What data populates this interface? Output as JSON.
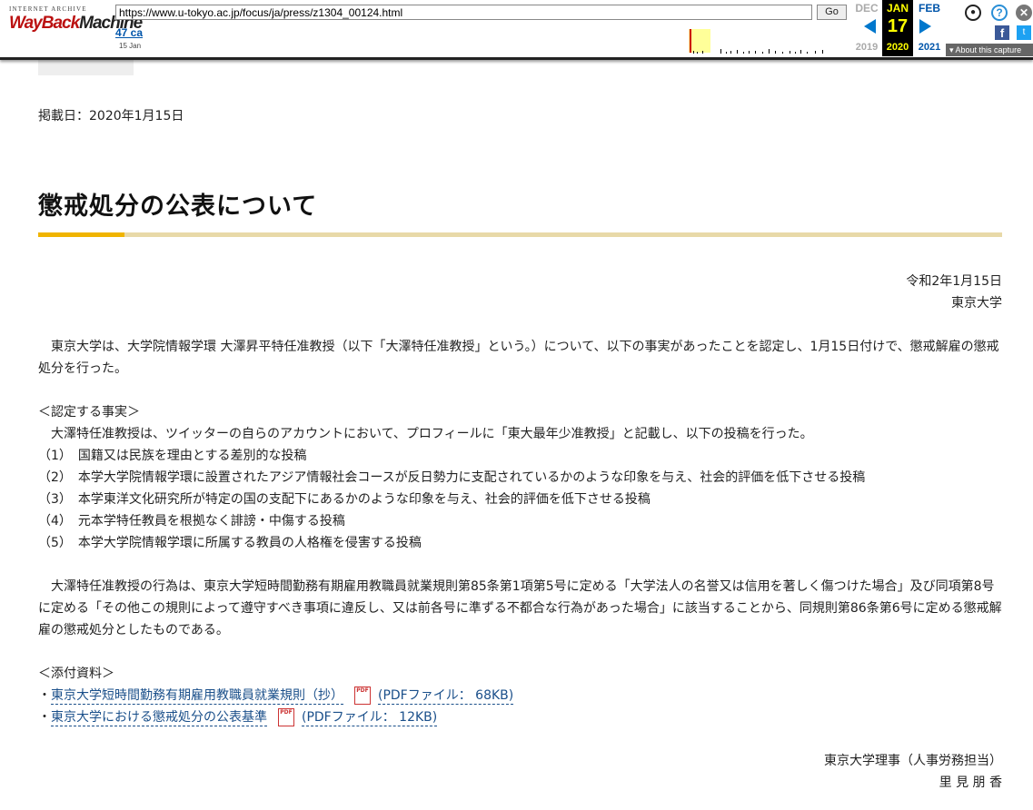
{
  "wayback": {
    "logo_top": "INTERNET ARCHIVE",
    "logo_main_a": "WayBack",
    "logo_main_b": "Machine",
    "url": "https://www.u-tokyo.ac.jp/focus/ja/press/z1304_00124.html",
    "go_label": "Go",
    "captures": "47 ca",
    "captures_date": "15 Jan",
    "prev_month": "DEC",
    "cur_month": "JAN",
    "next_month": "FEB",
    "day": "17",
    "prev_year": "2019",
    "cur_year": "2020",
    "next_year": "2021",
    "about": "About this capture",
    "close_glyph": "✕",
    "help_glyph": "?",
    "facebook_glyph": "f",
    "twitter_glyph": "t"
  },
  "page": {
    "post_date": "掲載日：2020年1月15日",
    "title": "懲戒処分の公表について",
    "issue_date": "令和2年1月15日",
    "issuer": "東京大学",
    "intro": "東京大学は、大学院情報学環 大澤昇平特任准教授（以下「大澤特任准教授」という。）について、以下の事実があったことを認定し、1月15日付けで、懲戒解雇の懲戒処分を行った。",
    "facts_heading": "＜認定する事実＞",
    "facts_intro": "　大澤特任准教授は、ツイッターの自らのアカウントにおいて、プロフィールに「東大最年少准教授」と記載し、以下の投稿を行った。",
    "facts": [
      "（1）　国籍又は民族を理由とする差別的な投稿",
      "（2）　本学大学院情報学環に設置されたアジア情報社会コースが反日勢力に支配されているかのような印象を与え、社会的評価を低下させる投稿",
      "（3）　本学東洋文化研究所が特定の国の支配下にあるかのような印象を与え、社会的評価を低下させる投稿",
      "（4）　元本学特任教員を根拠なく誹謗・中傷する投稿",
      "（5）　本学大学院情報学環に所属する教員の人格権を侵害する投稿"
    ],
    "conclusion": "大澤特任准教授の行為は、東京大学短時間勤務有期雇用教職員就業規則第85条第1項第5号に定める「大学法人の名誉又は信用を著しく傷つけた場合」及び同項第8号に定める「その他この規則によって遵守すべき事項に違反し、又は前各号に準ずる不都合な行為があった場合」に該当することから、同規則第86条第6号に定める懲戒解雇の懲戒処分としたものである。",
    "attachments_heading": "＜添付資料＞",
    "attachments": [
      {
        "bullet": "・",
        "label": "東京大学短時間勤務有期雇用教職員就業規則（抄）",
        "file_info": "(PDFファイル： 68KB)"
      },
      {
        "bullet": "・",
        "label": "東京大学における懲戒処分の公表基準",
        "file_info": "(PDFファイル： 12KB)"
      }
    ],
    "signature_title": "東京大学理事（人事労務担当）",
    "signature_name": "里 見 朋 香"
  },
  "colors": {
    "accent_rule": "#f0b400",
    "rule": "#e8d9a8",
    "link": "#1a4f8a"
  }
}
